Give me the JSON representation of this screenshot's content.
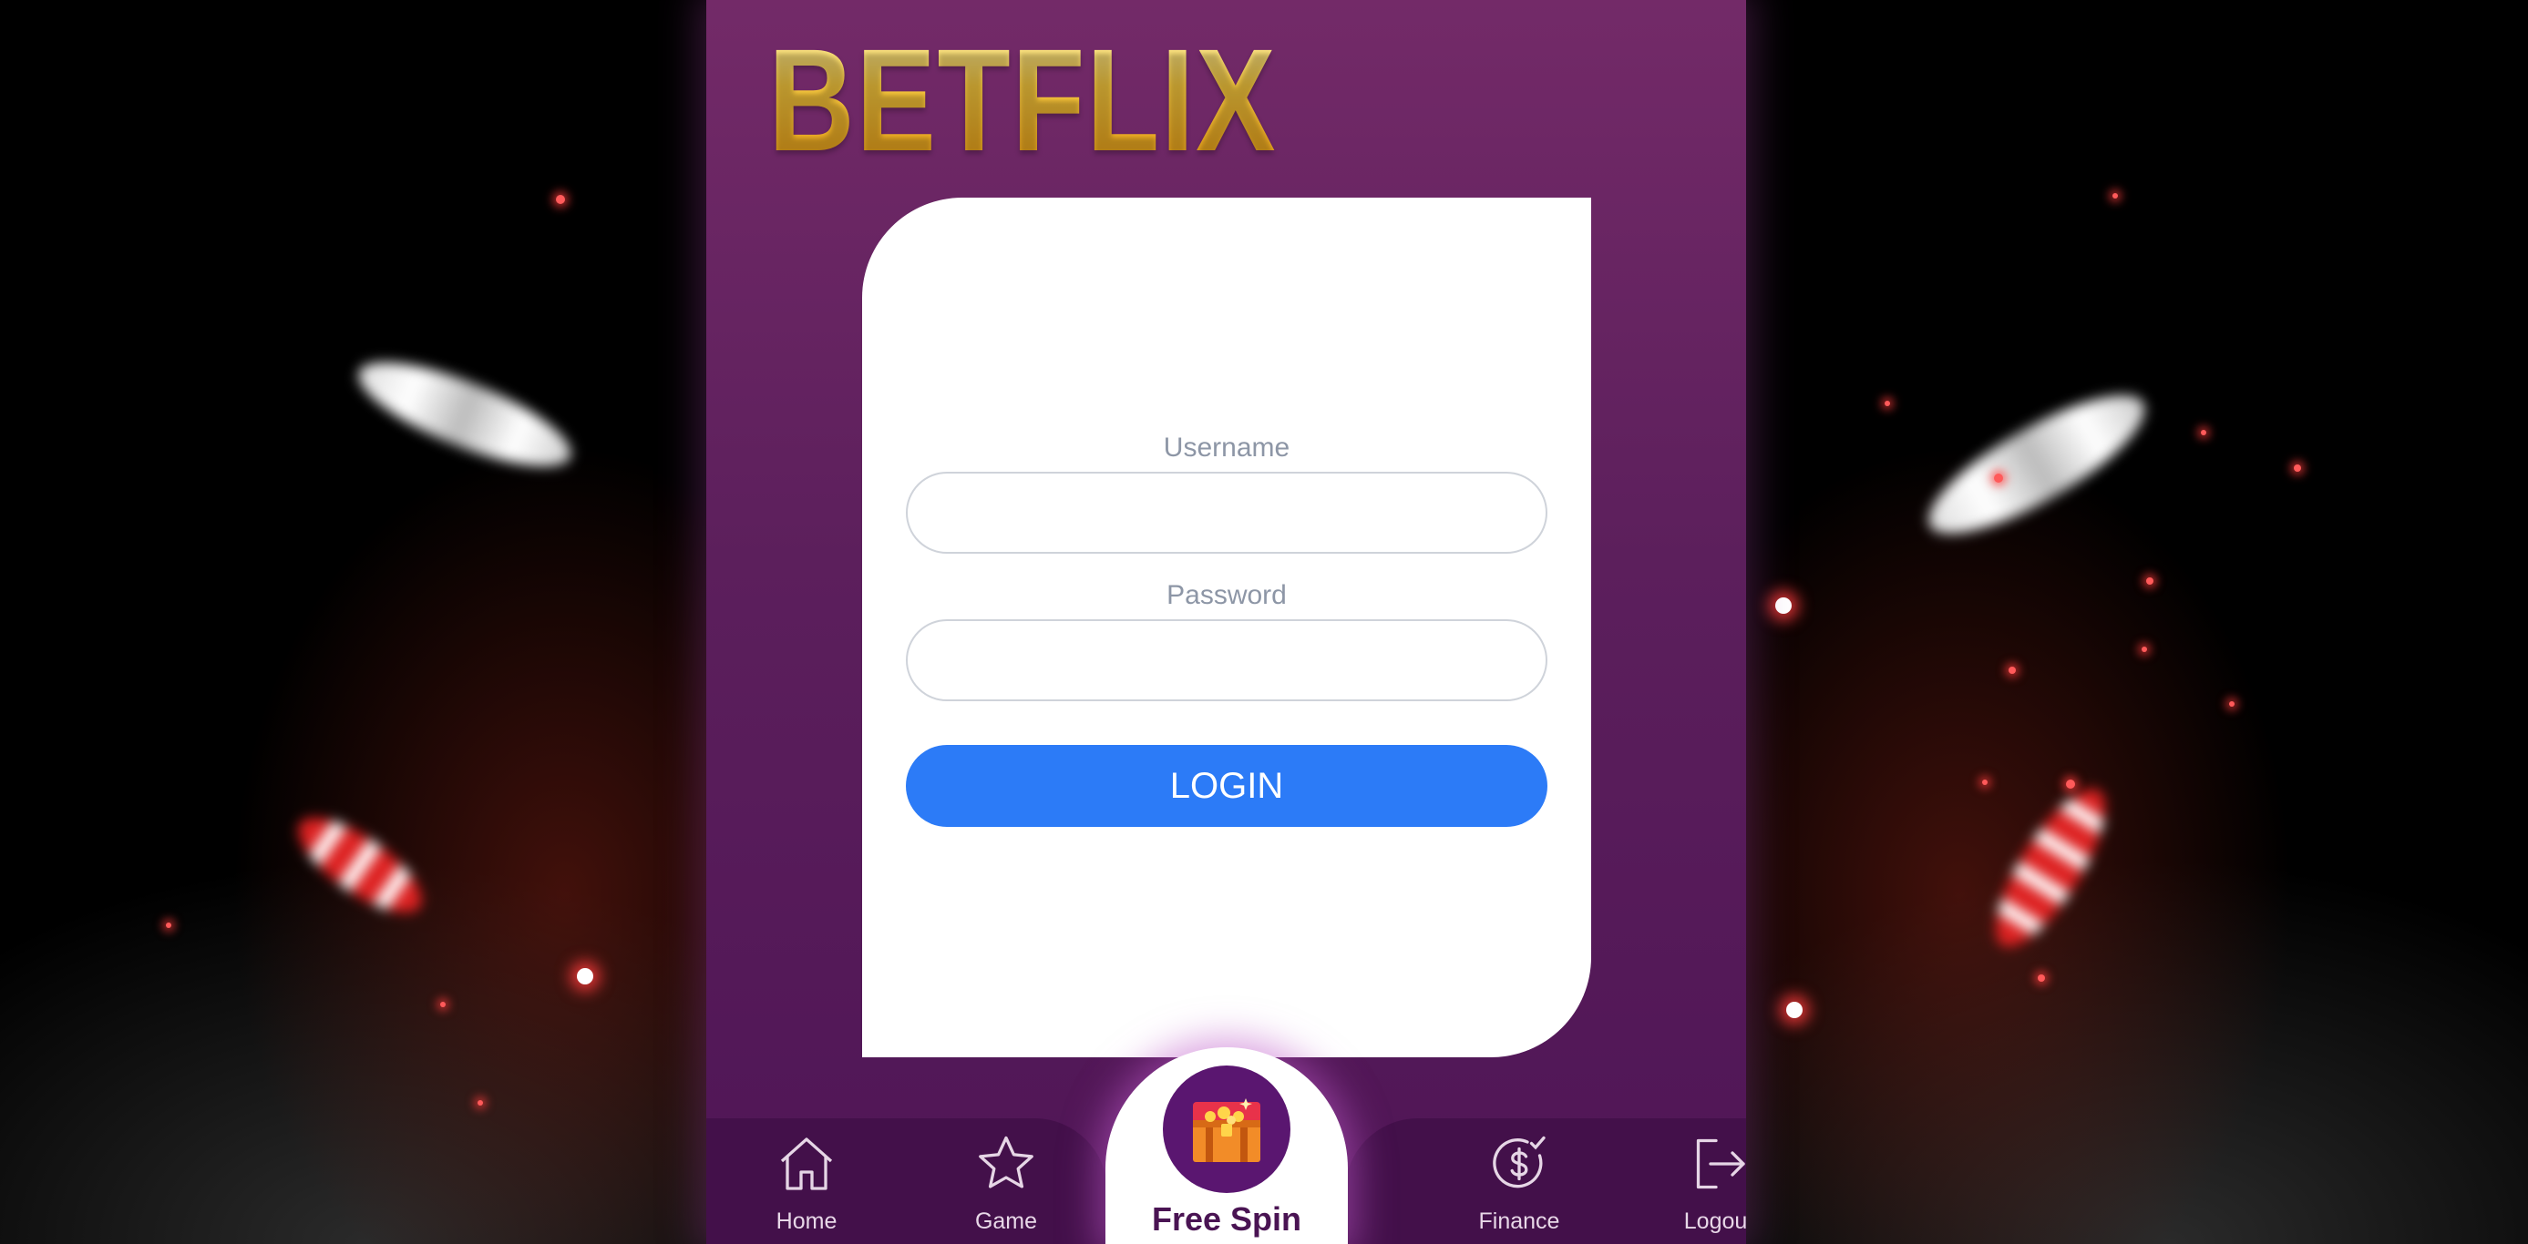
{
  "brand": {
    "logo_text": "BETFLIX"
  },
  "login_form": {
    "username_label": "Username",
    "username_value": "",
    "password_label": "Password",
    "password_value": "",
    "login_button": "LOGIN"
  },
  "bottom_nav": {
    "items": [
      {
        "label": "Home",
        "icon": "home-icon"
      },
      {
        "label": "Game",
        "icon": "star-icon"
      },
      {
        "label": "Free Spin",
        "icon": "treasure-chest-icon"
      },
      {
        "label": "Finance",
        "icon": "dollar-check-icon"
      },
      {
        "label": "Logout",
        "icon": "logout-icon"
      }
    ]
  },
  "colors": {
    "panel_purple": "#732a68",
    "nav_dark_purple": "#43104a",
    "login_blue": "#2c7bf7",
    "logo_gold": "#f8c93f"
  }
}
